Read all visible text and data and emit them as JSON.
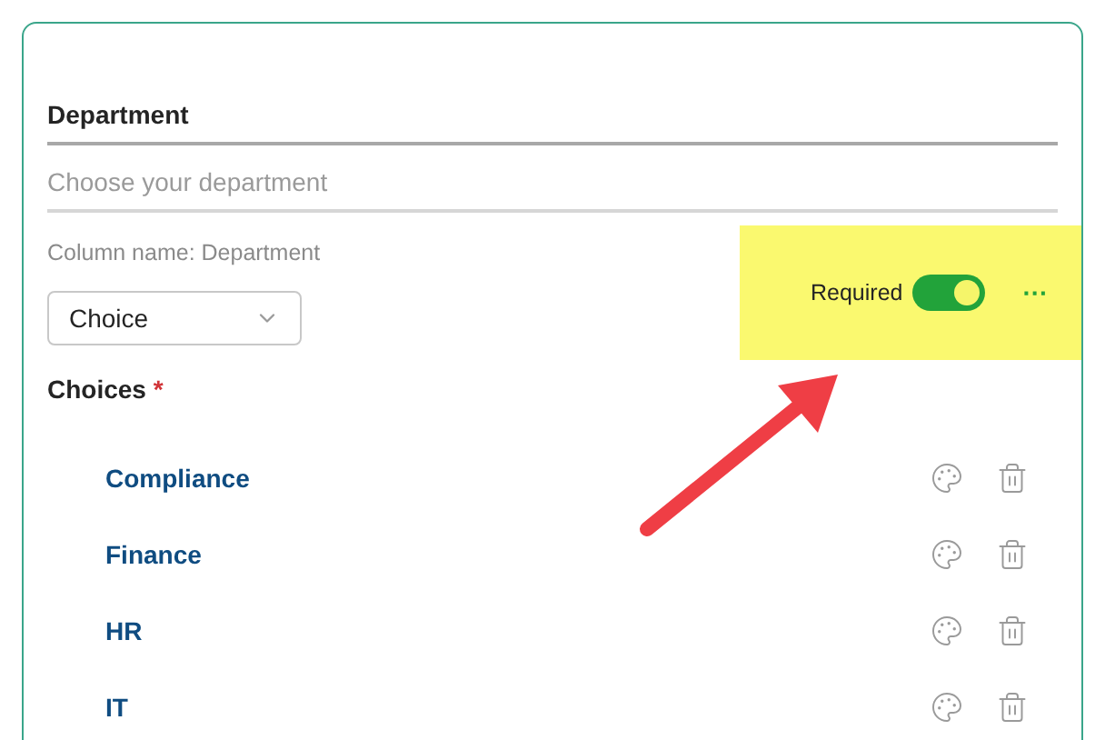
{
  "field": {
    "title": "Department",
    "placeholder": "Choose your department",
    "column_name": "Column name: Department"
  },
  "type_dropdown": {
    "value": "Choice"
  },
  "required": {
    "label": "Required",
    "on": true
  },
  "more_button": {
    "label": "···"
  },
  "choices": {
    "label": "Choices",
    "required_marker": "*",
    "items": [
      {
        "label": "Compliance"
      },
      {
        "label": "Finance"
      },
      {
        "label": "HR"
      },
      {
        "label": "IT"
      }
    ]
  }
}
